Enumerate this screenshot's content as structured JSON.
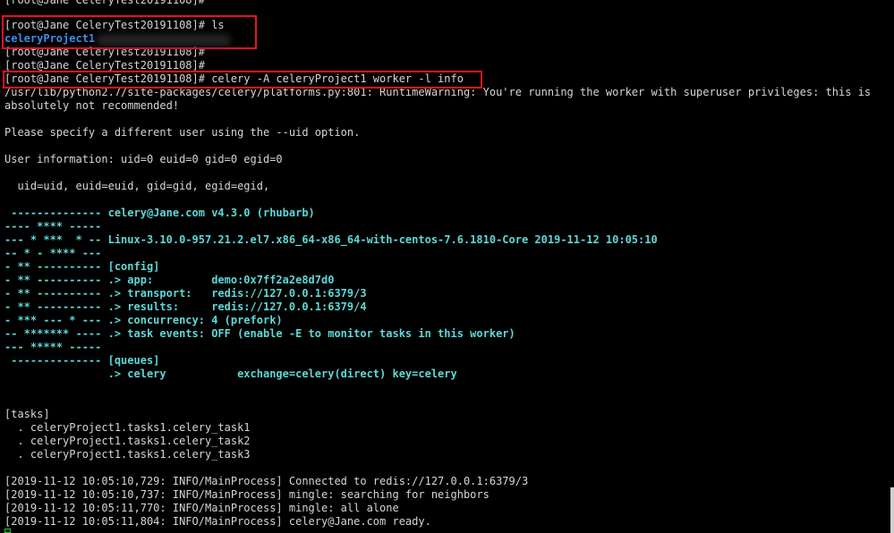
{
  "terminal": {
    "lines": [
      "[root@Jane CeleryTest20191108]#",
      "[root@Jane CeleryTest20191108]# ls",
      "celeryProject1",
      "[root@Jane CeleryTest20191108]#",
      "[root@Jane CeleryTest20191108]#",
      "[root@Jane CeleryTest20191108]# celery -A celeryProject1 worker -l info",
      "/usr/lib/python2.7/site-packages/celery/platforms.py:801: RuntimeWarning: You're running the worker with superuser privileges: this is",
      "absolutely not recommended!",
      "",
      "Please specify a different user using the --uid option.",
      "",
      "User information: uid=0 euid=0 gid=0 egid=0",
      "",
      "  uid=uid, euid=euid, gid=gid, egid=egid,",
      "",
      " -------------- celery@Jane.com v4.3.0 (rhubarb)",
      "---- **** -----",
      "--- * ***  * -- Linux-3.10.0-957.21.2.el7.x86_64-x86_64-with-centos-7.6.1810-Core 2019-11-12 10:05:10",
      "-- * - **** ---",
      "- ** ---------- [config]",
      "- ** ---------- .> app:         demo:0x7ff2a2e8d7d0",
      "- ** ---------- .> transport:   redis://127.0.0.1:6379/3",
      "- ** ---------- .> results:     redis://127.0.0.1:6379/4",
      "- *** --- * --- .> concurrency: 4 (prefork)",
      "-- ******* ---- .> task events: OFF (enable -E to monitor tasks in this worker)",
      "--- ***** -----",
      " -------------- [queues]",
      "                .> celery           exchange=celery(direct) key=celery",
      "",
      "",
      "[tasks]",
      "  . celeryProject1.tasks1.celery_task1",
      "  . celeryProject1.tasks1.celery_task2",
      "  . celeryProject1.tasks1.celery_task3",
      "",
      "[2019-11-12 10:05:10,729: INFO/MainProcess] Connected to redis://127.0.0.1:6379/3",
      "[2019-11-12 10:05:10,737: INFO/MainProcess] mingle: searching for neighbors",
      "[2019-11-12 10:05:11,770: INFO/MainProcess] mingle: all alone",
      "[2019-11-12 10:05:11,804: INFO/MainProcess] celery@Jane.com ready."
    ]
  },
  "colors": {
    "background": "#000000",
    "text": "#d6d6d6",
    "banner": "#5fd7d7",
    "directory": "#3b8eea",
    "highlight_box": "#e81123"
  }
}
